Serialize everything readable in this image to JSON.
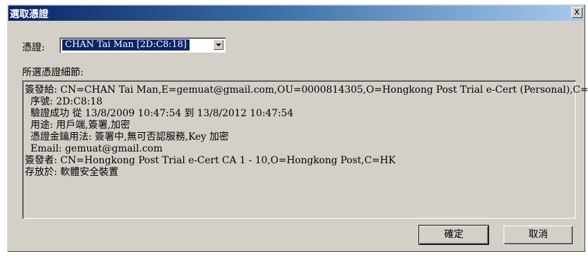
{
  "window": {
    "title": "選取憑證",
    "close_label": "x"
  },
  "certificate": {
    "label": "憑證:",
    "selected": "CHAN Tai Man [2D:C8:18]"
  },
  "details": {
    "heading": "所選憑證細節:",
    "lines": [
      "簽發給: CN=CHAN Tai Man,E=gemuat@gmail.com,OU=0000814305,O=Hongkong Post Trial e-Cert (Personal),C=HK",
      "序號: 2D:C8:18",
      "驗證成功 從 13/8/2009 10:47:54 到 13/8/2012 10:47:54",
      "用途: 用戶端,簽署,加密",
      "憑證金鑰用法: 簽署中,無可否認服務,Key 加密",
      "Email: gemuat@gmail.com",
      "簽發者: CN=Hongkong Post Trial e-Cert CA 1 - 10,O=Hongkong Post,C=HK",
      "存放於: 軟體安全裝置"
    ]
  },
  "buttons": {
    "ok": "確定",
    "cancel": "取消"
  }
}
